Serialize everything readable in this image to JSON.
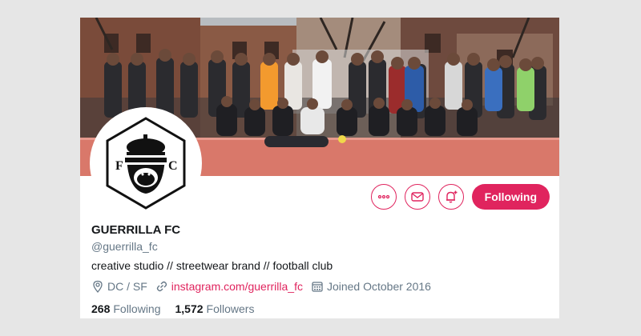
{
  "profile": {
    "name": "GUERRILLA FC",
    "handle": "@guerrilla_fc",
    "bio": "creative studio // streetwear brand // football club",
    "location": "DC / SF",
    "link": "instagram.com/guerrilla_fc",
    "joined": "Joined October 2016",
    "following_count": "268",
    "following_label": "Following",
    "followers_count": "1,572",
    "followers_label": "Followers",
    "avatar_letters": [
      "F",
      "C"
    ]
  },
  "actions": {
    "more_icon": "more-icon",
    "message_icon": "mail-icon",
    "notify_icon": "bell-plus-icon",
    "follow_label": "Following"
  },
  "colors": {
    "accent": "#e0245e",
    "text": "#14171a",
    "muted": "#657786"
  }
}
